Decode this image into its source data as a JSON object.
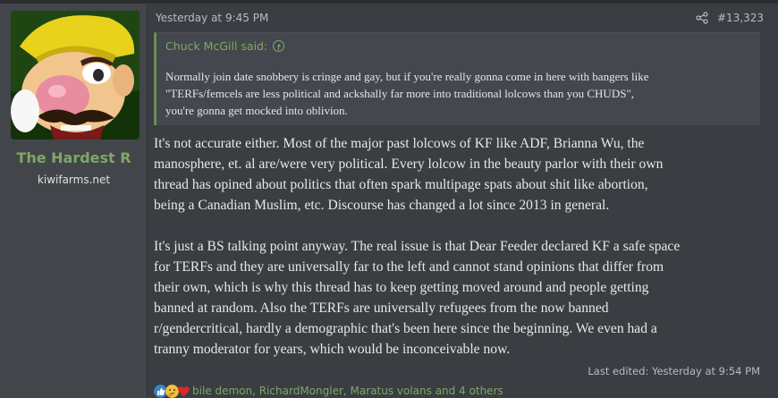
{
  "user": {
    "username": "The Hardest R",
    "title": "kiwifarms.net"
  },
  "post": {
    "date": "Yesterday at 9:45 PM",
    "number": "#13,323",
    "edited": "Last edited: Yesterday at 9:54 PM"
  },
  "quote": {
    "author": "Chuck McGill said:",
    "lines": [
      "Normally join date snobbery is cringe and gay, but if you're really gonna come in here with bangers like",
      "\"TERFs/femcels are less political and ackshally far more into traditional lolcows than you CHUDS\",",
      "you're gonna get mocked into oblivion."
    ]
  },
  "message": {
    "p1": [
      "It's not accurate either. Most of the major past lolcows of KF like ADF, Brianna Wu, the",
      "manosphere, et. al are/were very political. Every lolcow in the beauty parlor with their own",
      "thread has opined about politics that often spark multipage spats about shit like abortion,",
      "being a Canadian Muslim, etc. Discourse has changed a lot since 2013 in general."
    ],
    "p2": [
      "It's just a BS talking point anyway. The real issue is that Dear Feeder declared KF a safe space",
      "for TERFs and they are universally far to the left and cannot stand opinions that differ from",
      "their own, which is why this thread has to keep getting moved around and people getting",
      "banned at random. Also the TERFs are universally refugees from the now banned",
      "r/gendercritical, hardly a demographic that's been here since the beginning. We even had a",
      "tranny moderator for years, which would be inconceivable now."
    ]
  },
  "reactions": {
    "names": "bile demon, RichardMongler, Maratus volans and 4 others",
    "icons": [
      "thumbs-up-icon",
      "thinking-face-icon",
      "heart-icon"
    ]
  },
  "colors": {
    "accent": "#7fa765",
    "background": "#3a3d42"
  }
}
